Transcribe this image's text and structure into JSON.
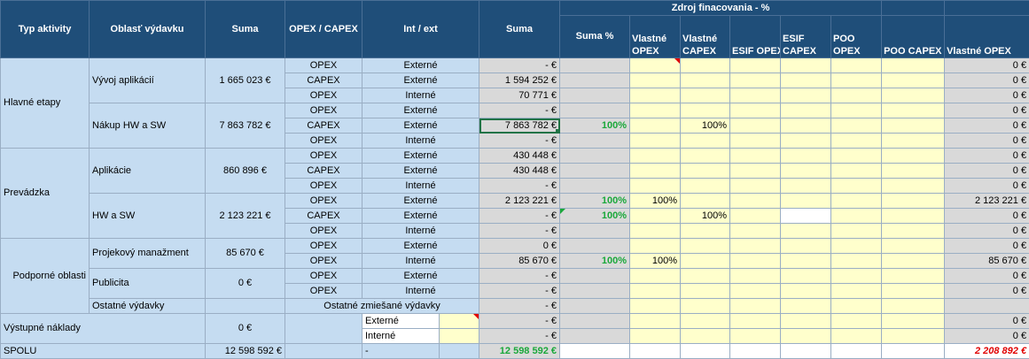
{
  "headers": {
    "typ_aktivity": "Typ aktivity",
    "oblast_vydavku": "Oblasť výdavku",
    "suma": "Suma",
    "opex_capex": "OPEX / CAPEX",
    "int_ext": "Int / ext",
    "suma2": "Suma",
    "zdroj": "Zdroj finacovania - %",
    "suma_pct": "Suma %",
    "vlastne_opex": "Vlastné OPEX",
    "vlastne_capex": "Vlastné CAPEX",
    "esif_opex": "ESIF OPEX",
    "esif_capex": "ESIF CAPEX",
    "poo_opex": "POO OPEX",
    "poo_capex": "POO CAPEX",
    "vlastne_opex2": "Vlastné OPEX"
  },
  "groups": {
    "hlavne": "Hlavné etapy",
    "prevadzka": "Prevádzka",
    "podporne": "Podporné oblasti",
    "vystupne": "Výstupné náklady",
    "vystupne_suma": "0 €",
    "spolu": "SPOLU"
  },
  "areas": {
    "a1": {
      "name": "Vývoj aplikácií",
      "sum": "1 665 023 €"
    },
    "a2": {
      "name": "Nákup HW a SW",
      "sum": "7 863 782 €"
    },
    "a3": {
      "name": "Aplikácie",
      "sum": "860 896 €"
    },
    "a4": {
      "name": "HW a SW",
      "sum": "2 123 221 €"
    },
    "a5": {
      "name": "Projekový manažment",
      "sum": "85 670 €"
    },
    "a6": {
      "name": "Publicita",
      "sum": "0 €"
    },
    "a7": {
      "name": "Ostatné výdavky",
      "mixed": "Ostatné zmiešané výdavky",
      "sum": "- €"
    }
  },
  "rows": [
    {
      "type": "OPEX",
      "ie": "Externé",
      "sum": "- €",
      "pct": "",
      "vo": "",
      "vc": "",
      "last": "0 €"
    },
    {
      "type": "CAPEX",
      "ie": "Externé",
      "sum": "1 594 252 €",
      "pct": "",
      "vo": "",
      "vc": "",
      "last": "0 €"
    },
    {
      "type": "OPEX",
      "ie": "Interné",
      "sum": "70 771 €",
      "pct": "",
      "vo": "",
      "vc": "",
      "last": "0 €"
    },
    {
      "type": "OPEX",
      "ie": "Externé",
      "sum": "- €",
      "pct": "",
      "vo": "",
      "vc": "",
      "last": "0 €"
    },
    {
      "type": "CAPEX",
      "ie": "Externé",
      "sum": "7 863 782 €",
      "pct": "100%",
      "vo": "",
      "vc": "100%",
      "last": "0 €"
    },
    {
      "type": "OPEX",
      "ie": "Interné",
      "sum": "- €",
      "pct": "",
      "vo": "",
      "vc": "",
      "last": "0 €"
    },
    {
      "type": "OPEX",
      "ie": "Externé",
      "sum": "430 448 €",
      "pct": "",
      "vo": "",
      "vc": "",
      "last": "0 €"
    },
    {
      "type": "CAPEX",
      "ie": "Externé",
      "sum": "430 448 €",
      "pct": "",
      "vo": "",
      "vc": "",
      "last": "0 €"
    },
    {
      "type": "OPEX",
      "ie": "Interné",
      "sum": "- €",
      "pct": "",
      "vo": "",
      "vc": "",
      "last": "0 €"
    },
    {
      "type": "OPEX",
      "ie": "Externé",
      "sum": "2 123 221 €",
      "pct": "100%",
      "vo": "100%",
      "vc": "",
      "last": "2 123 221 €"
    },
    {
      "type": "CAPEX",
      "ie": "Externé",
      "sum": "- €",
      "pct": "100%",
      "vo": "",
      "vc": "100%",
      "last": "0 €"
    },
    {
      "type": "OPEX",
      "ie": "Interné",
      "sum": "- €",
      "pct": "",
      "vo": "",
      "vc": "",
      "last": "0 €"
    },
    {
      "type": "OPEX",
      "ie": "Externé",
      "sum": "0 €",
      "pct": "",
      "vo": "",
      "vc": "",
      "last": "0 €"
    },
    {
      "type": "OPEX",
      "ie": "Interné",
      "sum": "85 670 €",
      "pct": "100%",
      "vo": "100%",
      "vc": "",
      "last": "85 670 €"
    },
    {
      "type": "OPEX",
      "ie": "Externé",
      "sum": "- €",
      "pct": "",
      "vo": "",
      "vc": "",
      "last": "0 €"
    },
    {
      "type": "OPEX",
      "ie": "Interné",
      "sum": "- €",
      "pct": "",
      "vo": "",
      "vc": "",
      "last": "0 €"
    }
  ],
  "vystupne_rows": [
    {
      "ie": "Externé",
      "sum": "- €",
      "last": "0 €"
    },
    {
      "ie": "Interné",
      "sum": "- €",
      "last": "0 €"
    }
  ],
  "total": {
    "sum": "12 598 592 €",
    "dash": "-",
    "sum2": "12 598 592 €",
    "last": "2 208 892 €"
  }
}
